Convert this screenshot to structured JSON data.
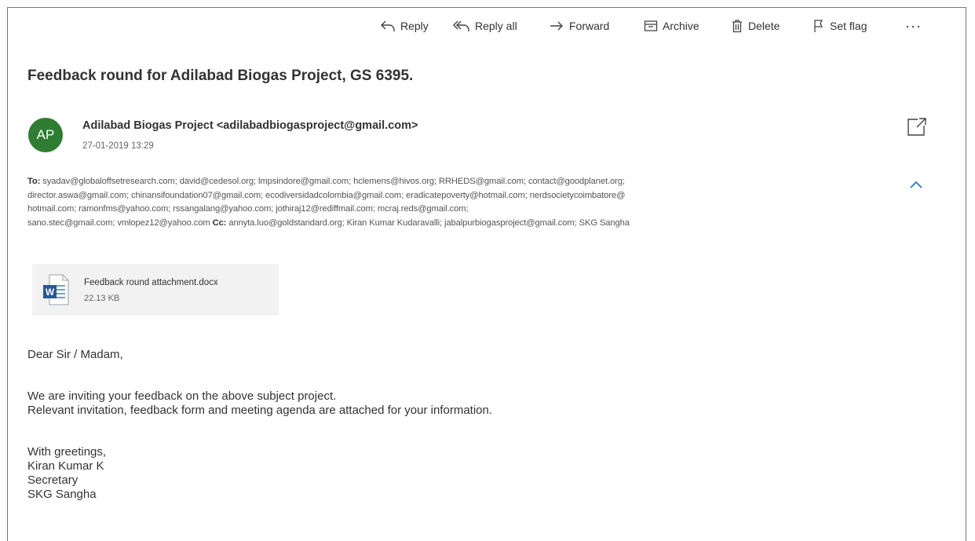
{
  "toolbar": {
    "reply": {
      "label": "Reply",
      "icon": "reply-icon"
    },
    "reply_all": {
      "label": "Reply all",
      "icon": "reply-all-icon"
    },
    "forward": {
      "label": "Forward",
      "icon": "forward-icon"
    },
    "archive": {
      "label": "Archive",
      "icon": "archive-icon"
    },
    "delete": {
      "label": "Delete",
      "icon": "trash-icon"
    },
    "flag": {
      "label": "Set flag",
      "icon": "flag-icon"
    },
    "more": {
      "label": "···",
      "icon": "more-icon"
    }
  },
  "message": {
    "subject": "Feedback round for Adilabad Biogas Project, GS 6395.",
    "sender": {
      "initials": "AP",
      "display": "Adilabad Biogas Project <adilabadbiogasproject@gmail.com>",
      "date": "27-01-2019 13:29",
      "avatar_color": "#2e7d32"
    },
    "recipients": {
      "to_label": "To:",
      "line1": "syadav@globaloffsetresearch.com;  david@cedesol.org;  lmpsindore@gmail.com;  hclemens@hivos.org;  RRHEDS@gmail.com;  contact@goodplanet.org;",
      "line2": "director.aswa@gmail.com;  chinansifoundation07@gmail.com;  ecodiversidadcolombia@gmail.com;  eradicatepoverty@hotmail.com;  nerdsocietycoimbatore@",
      "line3": "hotmail.com;  ramonfms@yahoo.com;  rssangalang@yahoo.com;  jothiraj12@rediffmail.com;  mcraj.reds@gmail.com;",
      "line4": "sano.stec@gmail.com;  vmlopez12@yahoo.com",
      "cc_label": "Cc:",
      "cc": "annyta.luo@goldstandard.org;  Kiran Kumar Kudaravalli;  jabalpurbiogasproject@gmail.com;  SKG Sangha"
    },
    "attachment": {
      "name": "Feedback round attachment.docx",
      "size": "22.13 KB",
      "icon": "word-document-icon"
    },
    "body": {
      "greeting": "Dear Sir / Madam,",
      "para1_line1": "We are inviting your feedback on the above subject project.",
      "para1_line2": "Relevant invitation, feedback form and meeting agenda are attached for your information.",
      "closing": "With greetings,",
      "sig_name": "Kiran Kumar K",
      "sig_title": "Secretary",
      "sig_org": "SKG Sangha"
    }
  }
}
